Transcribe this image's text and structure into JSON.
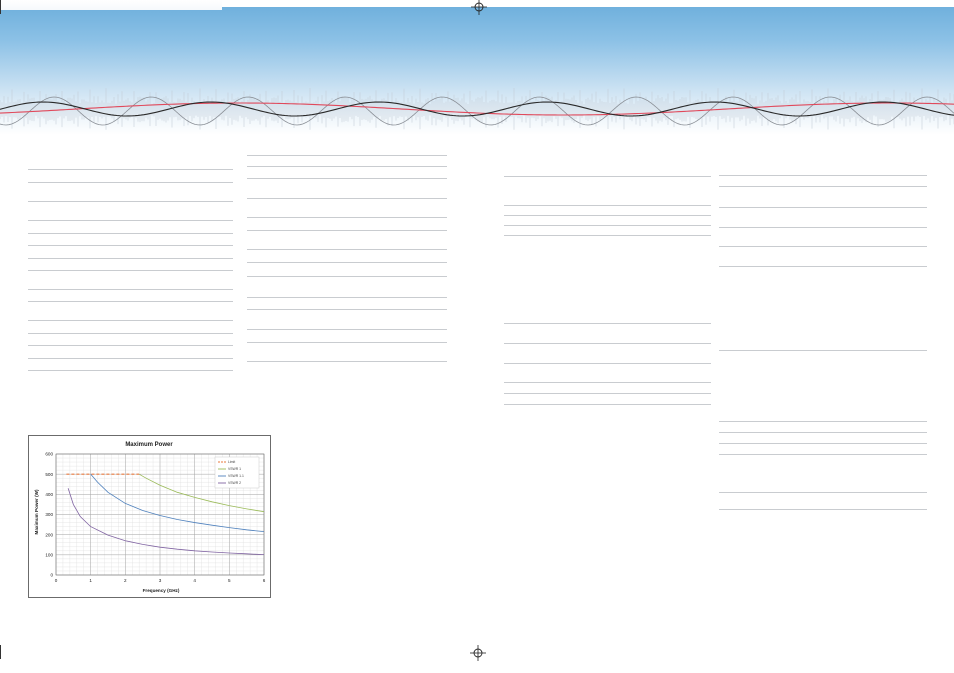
{
  "page": {
    "title": ""
  },
  "colors": {
    "banner_top": "#6aaddb",
    "wave_dark": "#2a2a2a",
    "wave_red": "#e0495b",
    "wave_gray": "#8a8f96",
    "rule": "#c9ccd0"
  },
  "chart_data": {
    "type": "line",
    "title": "Maximum Power",
    "xlabel": "Frequency (GHz)",
    "ylabel": "Maximum Power (W)",
    "xlim": [
      0,
      6
    ],
    "ylim": [
      0,
      600
    ],
    "xticks": [
      0,
      1,
      2,
      3,
      4,
      5,
      6
    ],
    "yticks": [
      0,
      100,
      200,
      300,
      400,
      500,
      600
    ],
    "grid": true,
    "legend_position": "top-right",
    "series": [
      {
        "name": "Limit",
        "color": "#e8783c",
        "dashed": true,
        "x": [
          0.3,
          2.4
        ],
        "y": [
          500,
          500
        ]
      },
      {
        "name": "VSWR 1",
        "color": "#9bbb59",
        "dashed": false,
        "x": [
          2.4,
          2.6,
          3.0,
          3.5,
          4.0,
          4.5,
          5.0,
          5.5,
          6.0
        ],
        "y": [
          500,
          480,
          445,
          410,
          385,
          363,
          344,
          328,
          314
        ]
      },
      {
        "name": "VSWR 1.1",
        "color": "#4f81bd",
        "dashed": false,
        "x": [
          1.0,
          1.2,
          1.5,
          2.0,
          2.5,
          3.0,
          3.5,
          4.0,
          4.5,
          5.0,
          5.5,
          6.0
        ],
        "y": [
          500,
          460,
          410,
          355,
          320,
          295,
          275,
          260,
          247,
          235,
          224,
          215
        ]
      },
      {
        "name": "VSWR 2",
        "color": "#8064a2",
        "dashed": false,
        "x": [
          0.35,
          0.5,
          0.7,
          1.0,
          1.5,
          2.0,
          2.5,
          3.0,
          3.5,
          4.0,
          4.5,
          5.0,
          5.5,
          6.0
        ],
        "y": [
          430,
          350,
          290,
          240,
          198,
          170,
          152,
          138,
          128,
          120,
          114,
          109,
          105,
          101
        ]
      }
    ]
  }
}
